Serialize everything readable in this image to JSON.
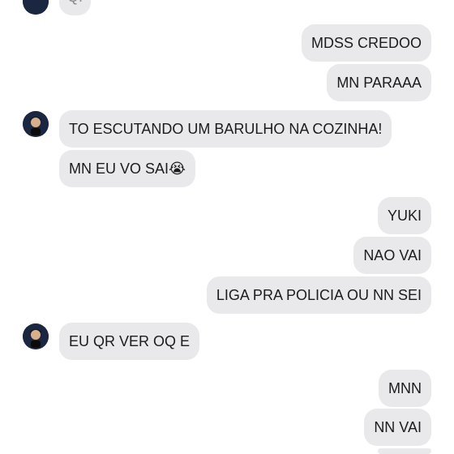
{
  "messages": {
    "top_partial": "Q!",
    "m1": "MDSS CREDOO",
    "m2": "MN PARAAA",
    "m3": "TO ESCUTANDO UM BARULHO NA COZINHA!",
    "m4": "MN EU VO SAI😭",
    "m5": "YUKI",
    "m6": "NAO VAI",
    "m7": "LIGA PRA POLICIA OU NN SEI",
    "m8": "EU QR VER OQ E",
    "m9": "MNN",
    "m10": "NN VAI"
  },
  "icons": {
    "contact_avatar": "contact-avatar-icon"
  },
  "colors": {
    "bubble": "#e9e9eb",
    "text": "#1c1c1e",
    "avatar_bg": "#1b2640"
  }
}
